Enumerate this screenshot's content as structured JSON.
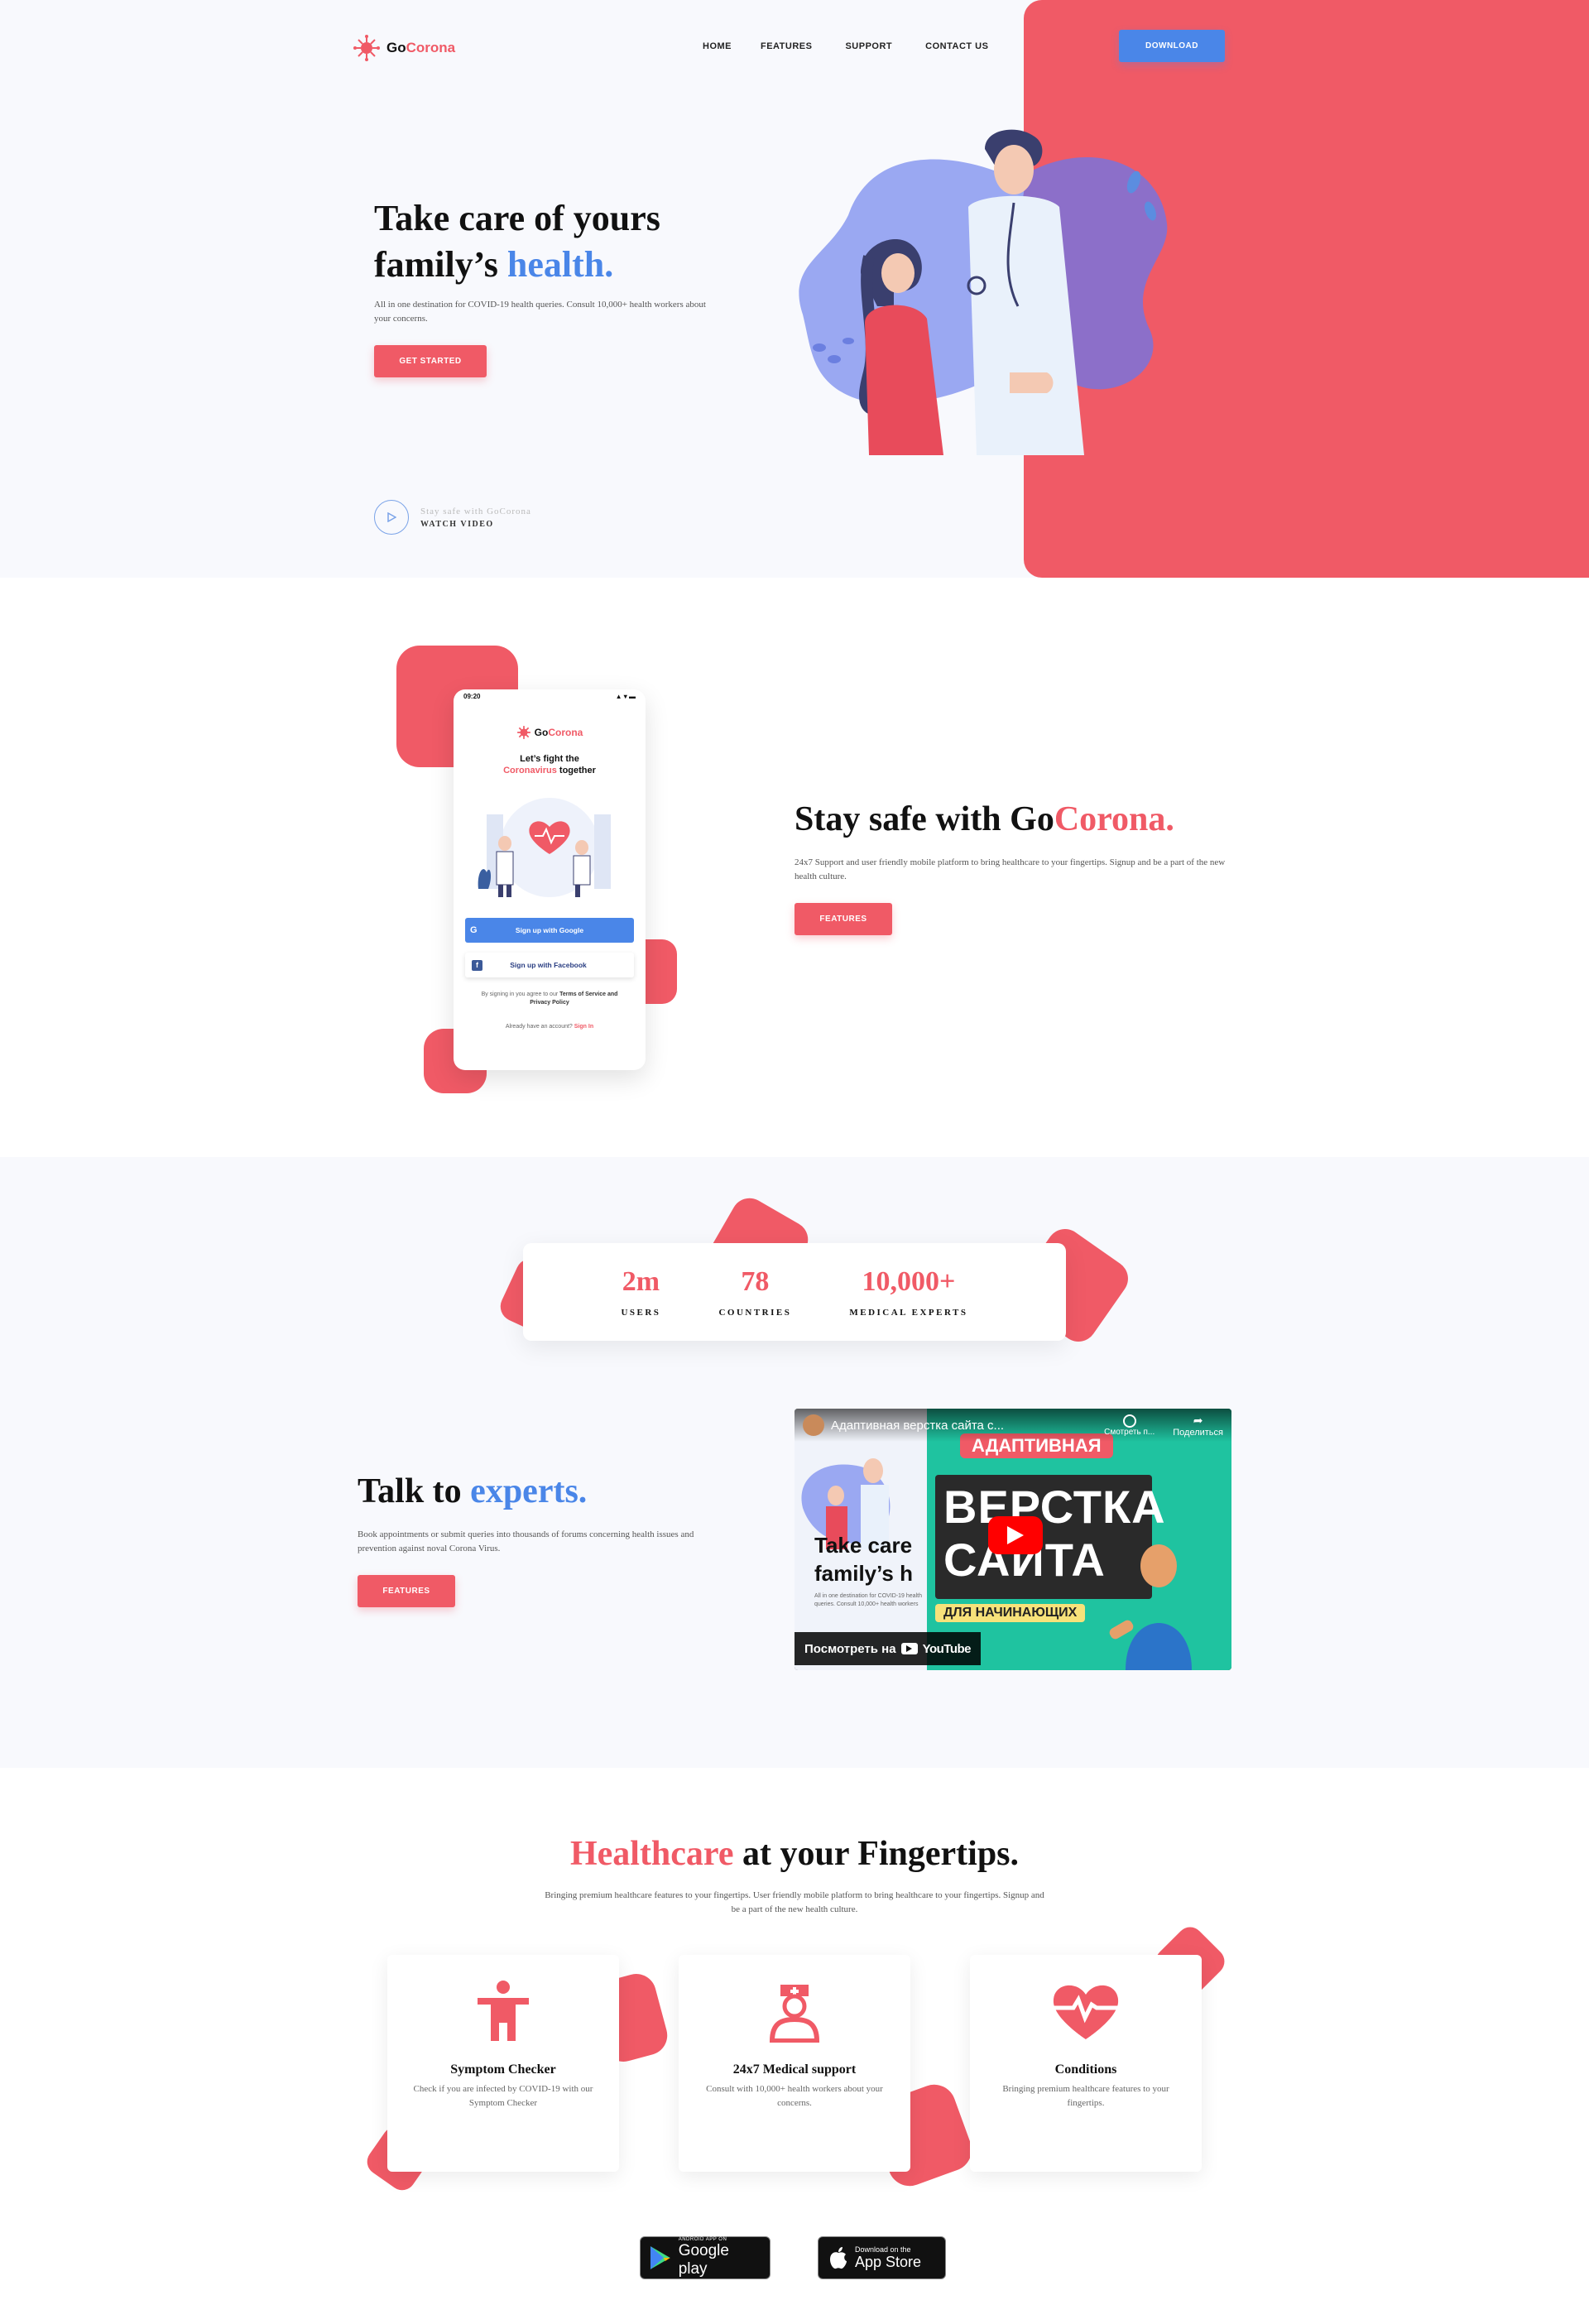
{
  "header": {
    "logo": {
      "brand_go": "Go",
      "brand_corona": "Corona"
    },
    "nav": [
      "HOME",
      "FEATURES",
      "SUPPORT",
      "CONTACT US"
    ],
    "download_label": "DOWNLOAD"
  },
  "hero": {
    "title_line1": "Take care of yours",
    "title_line2_a": "family’s ",
    "title_line2_b": "health.",
    "subtitle": "All in one destination for COVID-19 health queries. Consult 10,000+ health workers about your concerns.",
    "cta_label": "GET STARTED",
    "video_caption": "Stay safe with GoCorona",
    "video_label": "WATCH VIDEO"
  },
  "app_section": {
    "phone": {
      "time": "09:20",
      "brand_go": "Go",
      "brand_corona": "Corona",
      "tagline_a": "Let’s fight the",
      "tagline_b": "Coronavirus",
      "tagline_c": " together",
      "google_label": "Sign up with Google",
      "facebook_label": "Sign up with Facebook",
      "terms_a": "By signing in you agree to our ",
      "terms_b": "Terms of Service and Privacy Policy",
      "account_a": "Already have an account? ",
      "account_b": "Sign In"
    },
    "title_a": "Stay safe with Go",
    "title_b": "Corona.",
    "text": "24x7 Support and user friendly mobile platform to bring healthcare to your fingertips. Signup and be a part of the new health culture.",
    "cta_label": "FEATURES"
  },
  "stats": [
    {
      "value": "2m",
      "label": "USERS"
    },
    {
      "value": "78",
      "label": "COUNTRIES"
    },
    {
      "value": "10,000+",
      "label": "MEDICAL EXPERTS"
    }
  ],
  "experts": {
    "title_a": "Talk to ",
    "title_b": "experts.",
    "text": "Book appointments or submit queries into thousands of forums concerning health issues and prevention against noval Corona Virus.",
    "cta_label": "FEATURES"
  },
  "video": {
    "title": "Адаптивная верстка сайта с...",
    "watch_later": "Смотреть п...",
    "share": "Поделиться",
    "banner_top": "АДАПТИВНАЯ",
    "banner_big1": "ВЕРСТКА",
    "banner_big2": "САЙТА",
    "banner_small": "ДЛЯ НАЧИНАЮЩИХ",
    "preview_line1": "Take care",
    "preview_line2": "family’s h",
    "preview_sub": "All in one destination for COVID-19 health queries. Consult 10,000+ health workers",
    "watch_on": "Посмотреть на",
    "youtube": "YouTube"
  },
  "features": {
    "title_a": "Healthcare",
    "title_b": " at your Fingertips.",
    "subtitle": "Bringing premium healthcare features to your fingertips. User friendly mobile platform to bring healthcare to your fingertips. Signup and be a part of the new health culture.",
    "cards": [
      {
        "icon": "person-icon",
        "title": "Symptom Checker",
        "text": "Check if you are infected by COVID-19 with our Symptom Checker"
      },
      {
        "icon": "nurse-icon",
        "title": "24x7 Medical support",
        "text": "Consult with 10,000+ health workers about your concerns."
      },
      {
        "icon": "heart-pulse-icon",
        "title": "Conditions",
        "text": "Bringing premium healthcare features to your fingertips."
      }
    ]
  },
  "stores": {
    "google_small": "ANDROID APP ON",
    "google_big": "Google play",
    "apple_small": "Download on the",
    "apple_big": "App Store"
  },
  "colors": {
    "accent": "#f05a66",
    "blue": "#4a86e8",
    "bg": "#f8f9fd"
  }
}
